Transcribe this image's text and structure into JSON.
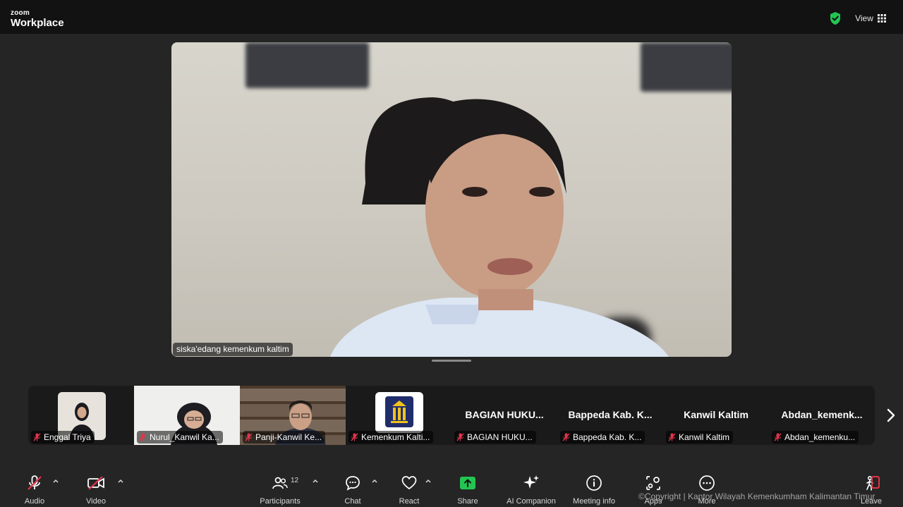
{
  "app": {
    "brand_small": "zoom",
    "brand_big": "Workplace"
  },
  "header": {
    "view_label": "View",
    "secure_color": "#23c552"
  },
  "main_video": {
    "speaker_name": "siska'edang kemenkum kaltim"
  },
  "participants_strip": [
    {
      "name": "Enggal Triya",
      "type": "video"
    },
    {
      "name": "Nurul_Kanwil Ka...",
      "type": "video"
    },
    {
      "name": "Panji-Kanwil Ke...",
      "type": "video"
    },
    {
      "name": "Kemenkum Kalti...",
      "type": "logo"
    },
    {
      "name": "BAGIAN HUKU...",
      "type": "name",
      "big_name": "BAGIAN HUKU..."
    },
    {
      "name": "Bappeda Kab. K...",
      "type": "name",
      "big_name": "Bappeda Kab. K..."
    },
    {
      "name": "Kanwil Kaltim",
      "type": "name",
      "big_name": "Kanwil Kaltim"
    },
    {
      "name": "Abdan_kemenku...",
      "type": "name",
      "big_name": "Abdan_kemenk..."
    }
  ],
  "toolbar": {
    "audio": "Audio",
    "video": "Video",
    "participants": "Participants",
    "participants_count": "12",
    "chat": "Chat",
    "react": "React",
    "share": "Share",
    "ai_companion": "AI Companion",
    "meeting_info": "Meeting info",
    "apps": "Apps",
    "more": "More",
    "leave": "Leave",
    "share_color": "#23c552",
    "leave_color": "#e0354a"
  },
  "watermark": "©Copyright | Kantor Wilayah Kemenkumham Kalimantan Timur"
}
